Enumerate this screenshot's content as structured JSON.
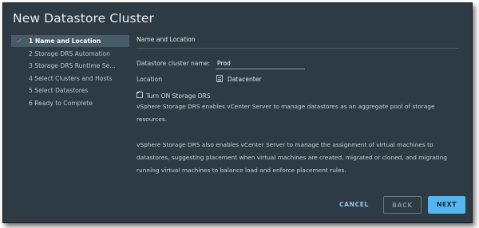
{
  "dialog": {
    "title": "New Datastore Cluster"
  },
  "steps": [
    {
      "label": "1 Name and Location",
      "active": true
    },
    {
      "label": "2 Storage DRS Automation"
    },
    {
      "label": "3 Storage DRS Runtime Se..."
    },
    {
      "label": "4 Select Clusters and Hosts"
    },
    {
      "label": "5 Select Datastores"
    },
    {
      "label": "6 Ready to Complete"
    }
  ],
  "main": {
    "section_title": "Name and Location",
    "name_label": "Datastore cluster name:",
    "name_value": "Prod",
    "location_label": "Location",
    "location_value": "Datacenter",
    "drs_checkbox_label": "Turn ON Storage DRS",
    "para1": "vSphere Storage DRS enables vCenter Server to manage datastores as an aggregate pool of storage resources.",
    "para2": "vSphere Storage DRS also enables vCenter Server to manage the assignment of virtual machines to datastores, suggesting placement when virtual machines are created, migrated or cloned, and migrating running virtual machines to balance load and enforce placement rules."
  },
  "buttons": {
    "cancel": "CANCEL",
    "back": "BACK",
    "next": "NEXT"
  }
}
